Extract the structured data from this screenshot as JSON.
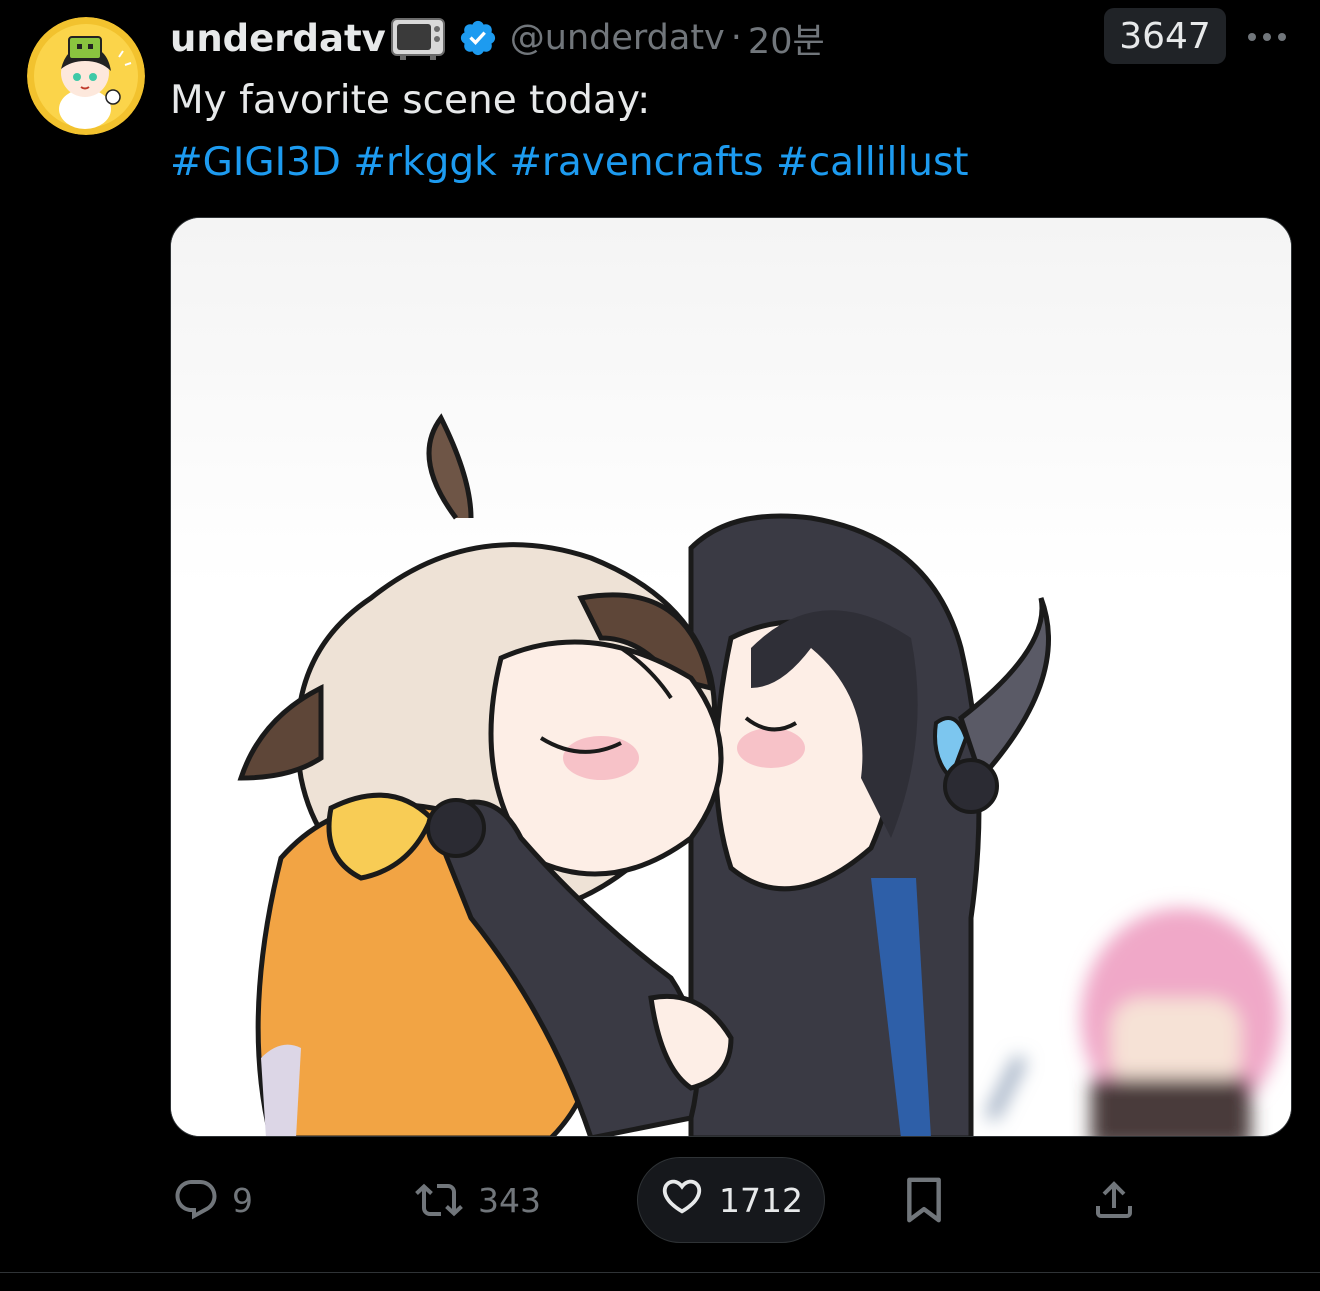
{
  "tweet": {
    "display_name": "underdatv",
    "handle": "@underdatv",
    "separator": "·",
    "time": "20분",
    "view_badge": "3647",
    "text_line": "My favorite scene today:",
    "hashtags": [
      "#GIGI3D",
      "#rkggk",
      "#ravencrafts",
      "#callillust"
    ],
    "icons": {
      "avatar": "avatar-image",
      "name_emoji": "tv-icon",
      "verified": "verified-badge-icon",
      "more": "more-icon"
    }
  },
  "actions": {
    "reply": {
      "icon": "reply-icon",
      "count": "9"
    },
    "retweet": {
      "icon": "retweet-icon",
      "count": "343"
    },
    "like": {
      "icon": "heart-icon",
      "count": "1712"
    },
    "bookmark": {
      "icon": "bookmark-icon"
    },
    "share": {
      "icon": "share-icon"
    }
  },
  "colors": {
    "background": "#000000",
    "text": "#e7e9ea",
    "muted": "#71767b",
    "link": "#1d9bf0",
    "verified": "#1d9bf0"
  }
}
